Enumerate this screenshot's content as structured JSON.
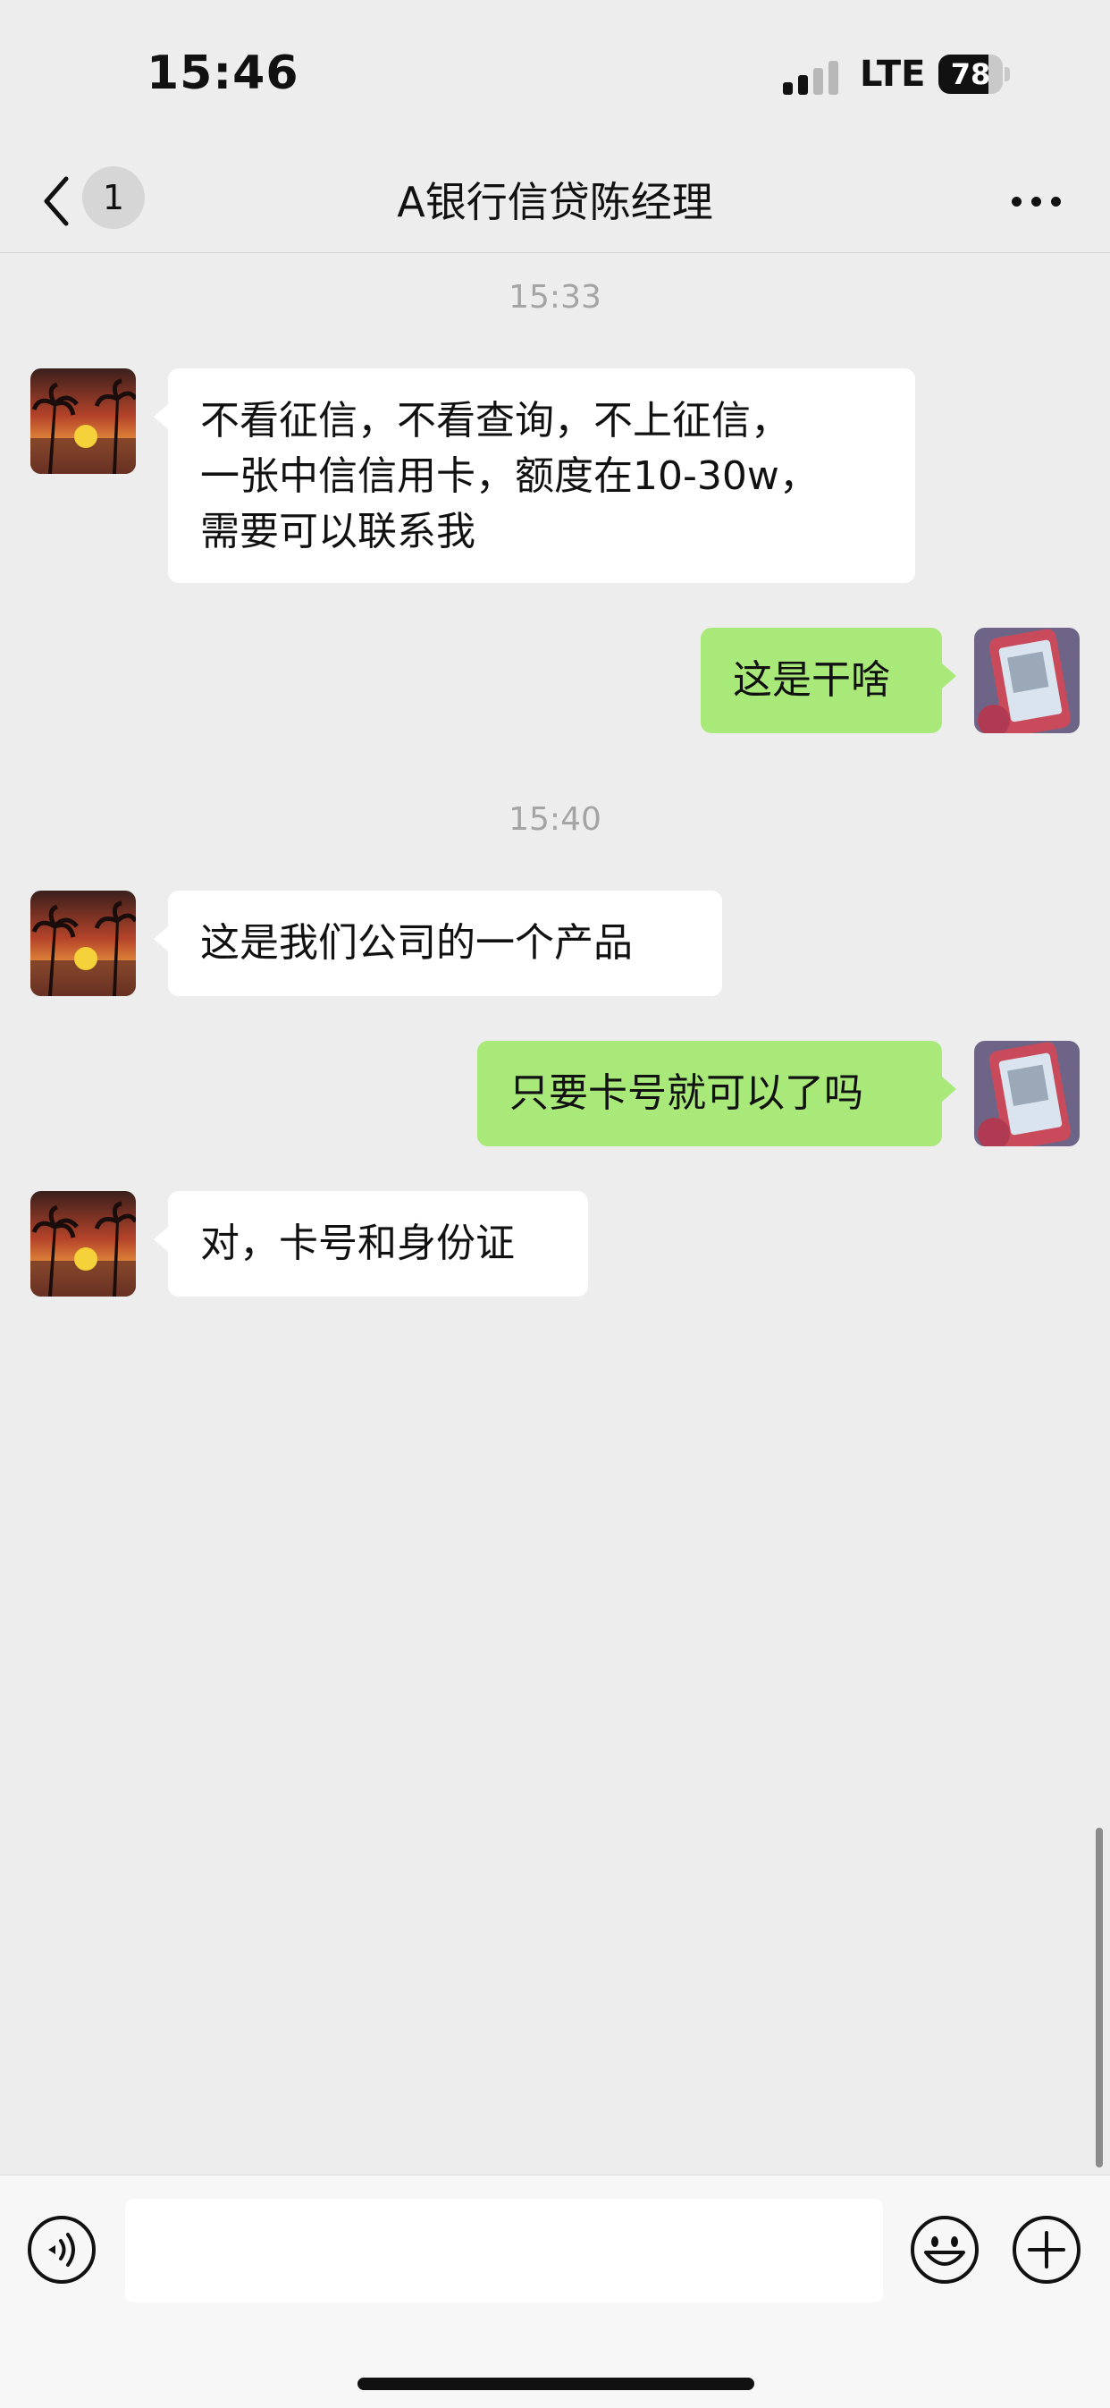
{
  "status_bar": {
    "time": "15:46",
    "network": "LTE",
    "battery": "78",
    "battery_level": 0.78
  },
  "nav": {
    "unread_count": "1",
    "title": "A银行信贷陈经理"
  },
  "chat": {
    "timestamps": [
      "15:33",
      "15:40"
    ],
    "messages": [
      {
        "side": "in",
        "text": "不看征信，不看查询，不上征信，\n一张中信信用卡，额度在10-30w，\n需要可以联系我"
      },
      {
        "side": "out",
        "text": "这是干啥"
      },
      {
        "side": "in",
        "text": "这是我们公司的一个产品"
      },
      {
        "side": "out",
        "text": "只要卡号就可以了吗"
      },
      {
        "side": "in",
        "text": "对，卡号和身份证"
      }
    ]
  },
  "input_bar": {
    "placeholder": ""
  },
  "colors": {
    "background": "#ededed",
    "outgoing_bubble": "#a9e97a",
    "incoming_bubble": "#ffffff"
  },
  "icons": [
    "back-icon",
    "more-icon",
    "voice-icon",
    "emoji-icon",
    "plus-icon"
  ]
}
